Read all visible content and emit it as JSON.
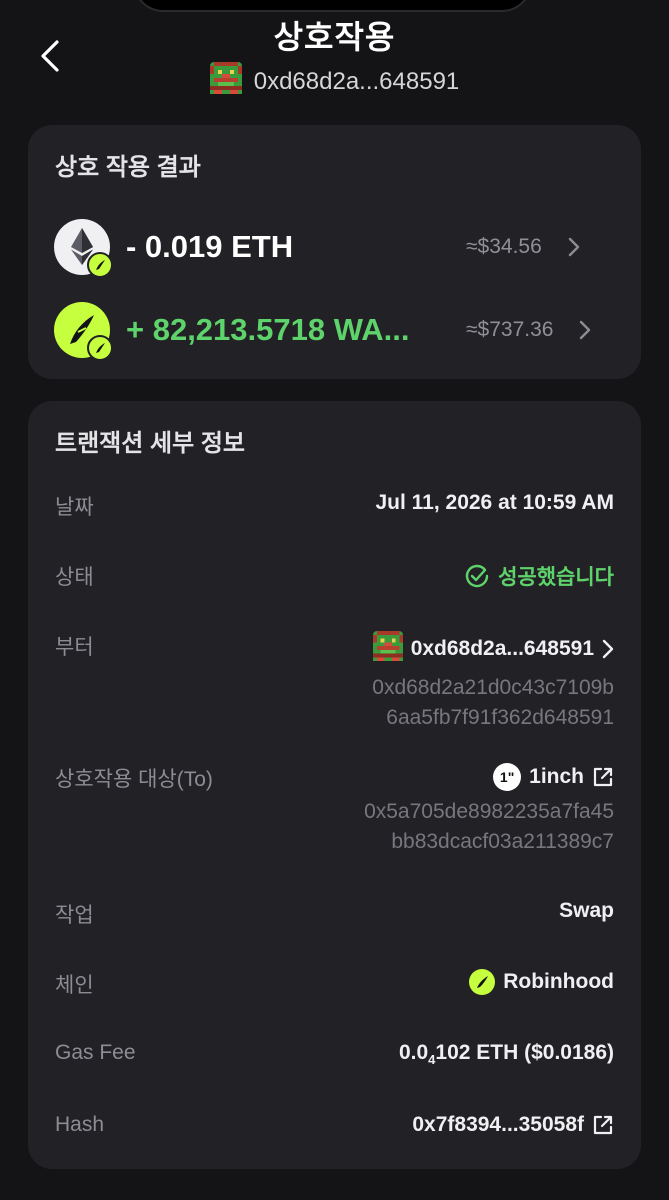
{
  "header": {
    "title": "상호작용",
    "address_short": "0xd68d2a...648591"
  },
  "result_card": {
    "title": "상호 작용 결과",
    "items": [
      {
        "icon": "ethereum-icon",
        "amount": "- 0.019 ETH",
        "usd": "≈$34.56"
      },
      {
        "icon": "robinhood-feather-icon",
        "amount": "+ 82,213.5718 WA...",
        "usd": "≈$737.36"
      }
    ]
  },
  "details_card": {
    "title": "트랜잭션 세부 정보",
    "date": {
      "label": "날짜",
      "value": "Jul 11, 2026 at 10:59 AM"
    },
    "status": {
      "label": "상태",
      "value": "성공했습니다"
    },
    "from": {
      "label": "부터",
      "short": "0xd68d2a...648591",
      "full_line1": "0xd68d2a21d0c43c7109b",
      "full_line2": "6aa5fb7f91f362d648591"
    },
    "to": {
      "label": "상호작용 대상(To)",
      "name": "1inch",
      "full_line1": "0x5a705de8982235a7fa45",
      "full_line2": "bb83dcacf03a211389c7"
    },
    "action": {
      "label": "작업",
      "value": "Swap"
    },
    "chain": {
      "label": "체인",
      "value": "Robinhood"
    },
    "gas": {
      "label": "Gas Fee",
      "value_prefix": "0.0",
      "value_sub": "4",
      "value_suffix": "102 ETH ($0.0186)"
    },
    "hash": {
      "label": "Hash",
      "value": "0x7f8394...35058f"
    }
  },
  "colors": {
    "background": "#141416",
    "card": "#222226",
    "positive": "#5fd36b",
    "robinhood_accent": "#c6ff3d"
  }
}
